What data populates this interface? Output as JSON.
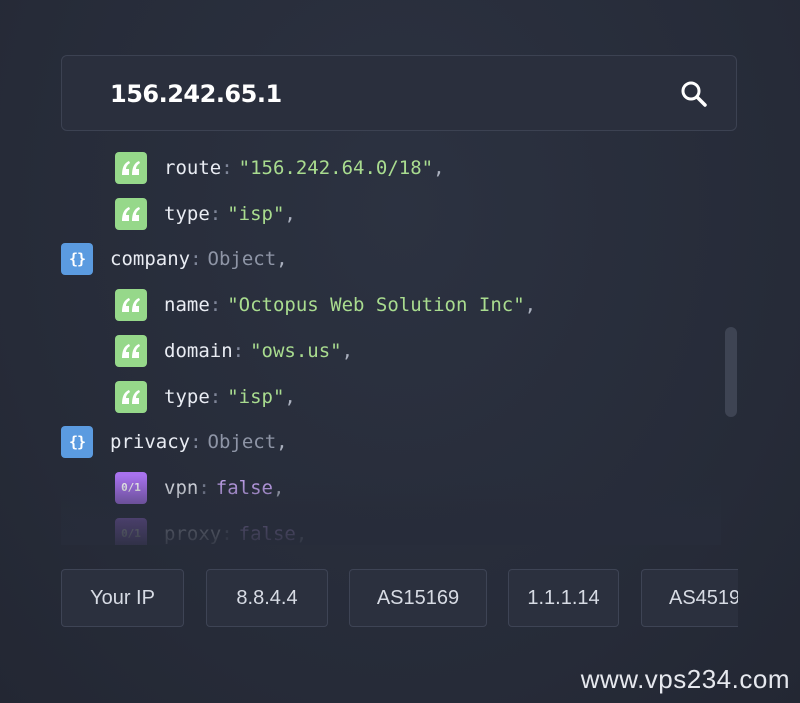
{
  "search": {
    "value": "156.242.65.1",
    "icon": "search-icon"
  },
  "json_rows": [
    {
      "level": 2,
      "type": "string",
      "key": "route",
      "value": "\"156.242.64.0/18\"",
      "comma": ","
    },
    {
      "level": 2,
      "type": "string",
      "key": "type",
      "value": "\"isp\"",
      "comma": ","
    },
    {
      "level": 1,
      "type": "object",
      "key": "company",
      "value": "Object",
      "comma": ","
    },
    {
      "level": 2,
      "type": "string",
      "key": "name",
      "value": "\"Octopus Web Solution Inc\"",
      "comma": ","
    },
    {
      "level": 2,
      "type": "string",
      "key": "domain",
      "value": "\"ows.us\"",
      "comma": ","
    },
    {
      "level": 2,
      "type": "string",
      "key": "type",
      "value": "\"isp\"",
      "comma": ","
    },
    {
      "level": 1,
      "type": "object",
      "key": "privacy",
      "value": "Object",
      "comma": ","
    },
    {
      "level": 2,
      "type": "boolean",
      "key": "vpn",
      "value": "false",
      "comma": ","
    },
    {
      "level": 2,
      "type": "boolean",
      "key": "proxy",
      "value": "false",
      "comma": ","
    }
  ],
  "badges": {
    "object_glyph": "{}",
    "boolean_glyph": "0/1",
    "string_icon": "quote-icon"
  },
  "colon": ":",
  "chips": [
    "Your IP",
    "8.8.4.4",
    "AS15169",
    "1.1.1.14",
    "AS4519"
  ],
  "watermark": "www.vps234.com",
  "colors": {
    "background": "#272c3a",
    "string_badge": "#96d88a",
    "object_badge": "#5b9be0",
    "boolean_badge": "#a872ee",
    "string_value": "#a9dc8f",
    "boolean_value": "#c9a7f5"
  }
}
